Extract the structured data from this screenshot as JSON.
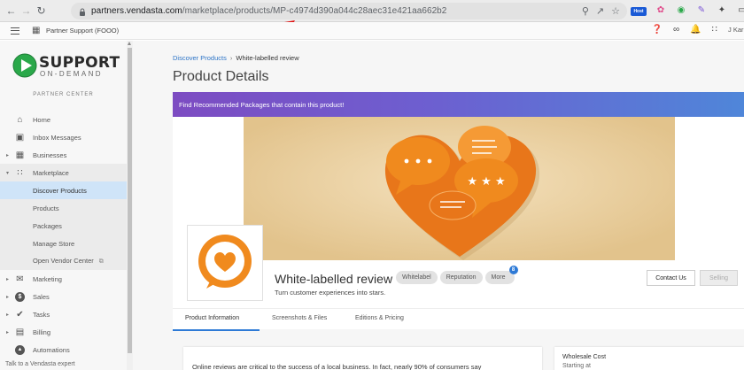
{
  "browser": {
    "url_host": "partners.vendasta.com",
    "url_path": "/marketplace/products/MP-c4974d390a044c28aec31e421aa662b2",
    "extensions": [
      "zoom-icon",
      "share-icon",
      "star-icon",
      "host-extension",
      "puzzle-extension",
      "green-extension",
      "pen-extension",
      "puzzle-icon",
      "sidepanel-icon"
    ],
    "host_label": "Host"
  },
  "topbar": {
    "org_name": "Partner Support (FOOO)",
    "user": "J Kar"
  },
  "sidebar": {
    "logo_word": "SUPPORT",
    "logo_sub": "ON-DEMAND",
    "partner_center": "PARTNER CENTER",
    "items": [
      {
        "label": "Home",
        "icon": "home-icon"
      },
      {
        "label": "Inbox Messages",
        "icon": "inbox-icon"
      },
      {
        "label": "Businesses",
        "icon": "building-icon"
      },
      {
        "label": "Marketplace",
        "icon": "grid-icon"
      },
      {
        "label": "Discover Products"
      },
      {
        "label": "Products"
      },
      {
        "label": "Packages"
      },
      {
        "label": "Manage Store"
      },
      {
        "label": "Open Vendor Center"
      },
      {
        "label": "Marketing",
        "icon": "mail-icon"
      },
      {
        "label": "Sales",
        "icon": "dollar-icon"
      },
      {
        "label": "Tasks",
        "icon": "check-circle-icon"
      },
      {
        "label": "Billing",
        "icon": "billing-icon"
      },
      {
        "label": "Automations",
        "icon": "automation-icon"
      }
    ],
    "footer": "Talk to a Vendasta expert"
  },
  "main": {
    "breadcrumb_link": "Discover Products",
    "breadcrumb_sep": "›",
    "breadcrumb_current": "White-labelled review",
    "title": "Product Details",
    "banner": "Find Recommended Packages that contain this product!",
    "product": {
      "name": "White-labelled review",
      "tags": [
        "Whitelabel",
        "Reputation",
        "More"
      ],
      "more_count": "8",
      "tagline": "Turn customer experiences into stars.",
      "contact_label": "Contact Us",
      "selling_label": "Selling"
    },
    "tabs": [
      "Product Information",
      "Screenshots & Files",
      "Editions & Pricing"
    ],
    "description": "Online reviews are critical to the success of a local business. In fact, nearly 90% of consumers say",
    "wholesale_title": "Wholesale Cost",
    "wholesale_sub": "Starting at"
  },
  "colors": {
    "accent_blue": "#2d74c7",
    "banner_start": "#7d4cc2",
    "banner_end": "#4f86d9",
    "brand_orange": "#f08a1e",
    "hero_bg": "#e8cf9f",
    "annotation_red": "#e01010"
  }
}
